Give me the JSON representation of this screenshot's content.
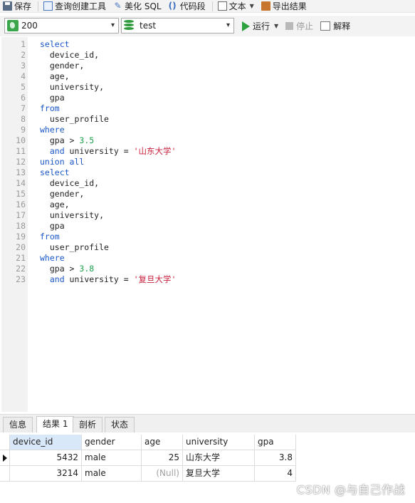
{
  "toolbar": {
    "save": "保存",
    "query_builder": "查询创建工具",
    "beautify": "美化 SQL",
    "snippet": "代码段",
    "text": "文本",
    "export": "导出结果"
  },
  "selectors": {
    "connection": "200",
    "database": "test",
    "run": "运行",
    "stop": "停止",
    "explain": "解释"
  },
  "editor": {
    "lines": [
      {
        "n": "1",
        "tokens": [
          {
            "t": "select",
            "c": "kw"
          }
        ]
      },
      {
        "n": "2",
        "tokens": [
          {
            "t": "  device_id,",
            "c": "ident"
          }
        ]
      },
      {
        "n": "3",
        "tokens": [
          {
            "t": "  gender,",
            "c": "ident"
          }
        ]
      },
      {
        "n": "4",
        "tokens": [
          {
            "t": "  age,",
            "c": "ident"
          }
        ]
      },
      {
        "n": "5",
        "tokens": [
          {
            "t": "  university,",
            "c": "ident"
          }
        ]
      },
      {
        "n": "6",
        "tokens": [
          {
            "t": "  gpa",
            "c": "ident"
          }
        ]
      },
      {
        "n": "7",
        "tokens": [
          {
            "t": "from",
            "c": "kw"
          }
        ]
      },
      {
        "n": "8",
        "tokens": [
          {
            "t": "  user_profile",
            "c": "ident"
          }
        ]
      },
      {
        "n": "9",
        "tokens": [
          {
            "t": "where",
            "c": "kw"
          }
        ]
      },
      {
        "n": "10",
        "tokens": [
          {
            "t": "  gpa > ",
            "c": "ident"
          },
          {
            "t": "3.5",
            "c": "num"
          }
        ]
      },
      {
        "n": "11",
        "tokens": [
          {
            "t": "  and",
            "c": "kw"
          },
          {
            "t": " university = ",
            "c": "ident"
          },
          {
            "t": "'山东大学'",
            "c": "str"
          }
        ]
      },
      {
        "n": "12",
        "tokens": [
          {
            "t": "union all",
            "c": "kw"
          }
        ]
      },
      {
        "n": "13",
        "tokens": [
          {
            "t": "select",
            "c": "kw"
          }
        ]
      },
      {
        "n": "14",
        "tokens": [
          {
            "t": "  device_id,",
            "c": "ident"
          }
        ]
      },
      {
        "n": "15",
        "tokens": [
          {
            "t": "  gender,",
            "c": "ident"
          }
        ]
      },
      {
        "n": "16",
        "tokens": [
          {
            "t": "  age,",
            "c": "ident"
          }
        ]
      },
      {
        "n": "17",
        "tokens": [
          {
            "t": "  university,",
            "c": "ident"
          }
        ]
      },
      {
        "n": "18",
        "tokens": [
          {
            "t": "  gpa",
            "c": "ident"
          }
        ]
      },
      {
        "n": "19",
        "tokens": [
          {
            "t": "from",
            "c": "kw"
          }
        ]
      },
      {
        "n": "20",
        "tokens": [
          {
            "t": "  user_profile",
            "c": "ident"
          }
        ]
      },
      {
        "n": "21",
        "tokens": [
          {
            "t": "where",
            "c": "kw"
          }
        ]
      },
      {
        "n": "22",
        "tokens": [
          {
            "t": "  gpa > ",
            "c": "ident"
          },
          {
            "t": "3.8",
            "c": "num"
          }
        ]
      },
      {
        "n": "23",
        "tokens": [
          {
            "t": "  and",
            "c": "kw"
          },
          {
            "t": " university = ",
            "c": "ident"
          },
          {
            "t": "'复旦大学'",
            "c": "str"
          }
        ]
      }
    ]
  },
  "tabs": [
    "信息",
    "结果 1",
    "剖析",
    "状态"
  ],
  "active_tab": "结果 1",
  "results": {
    "columns": [
      "device_id",
      "gender",
      "age",
      "university",
      "gpa"
    ],
    "rows": [
      [
        "5432",
        "male",
        "25",
        "山东大学",
        "3.8"
      ],
      [
        "3214",
        "male",
        "(Null)",
        "复旦大学",
        "4"
      ]
    ]
  },
  "watermark": "CSDN @与自己作战",
  "colors": {
    "keyword": "#1a57c8",
    "number": "#1fa34d",
    "string": "#c8203c",
    "run": "#2ea23e",
    "header_selected": "#d9e8f8"
  }
}
